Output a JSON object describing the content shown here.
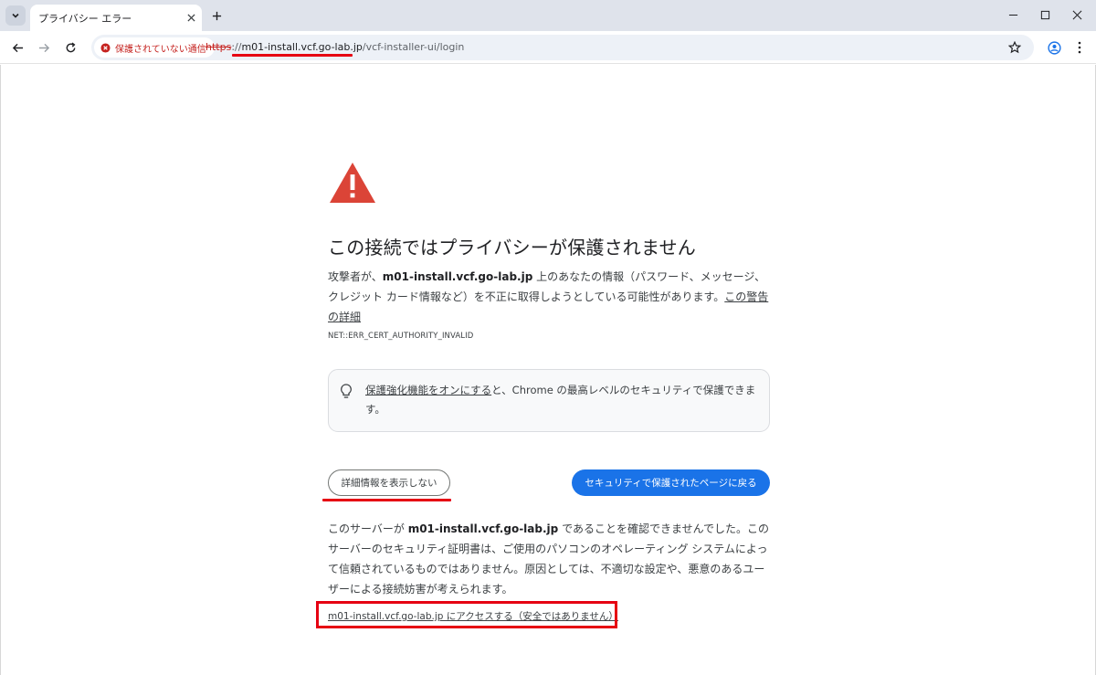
{
  "browser": {
    "tab_title": "プライバシー エラー",
    "address": {
      "security_label": "保護されていない通信",
      "url_scheme": "https",
      "url_sep": "://",
      "url_host": "m01-install.vcf.go-lab.jp",
      "url_path": "/vcf-installer-ui/login"
    },
    "icons": {
      "tab_search": "chevron-down-icon",
      "tab_close": "close-icon",
      "new_tab": "plus-icon",
      "back": "arrow-left-icon",
      "forward": "arrow-right-icon",
      "reload": "reload-icon",
      "security": "error-circle-icon",
      "bookmark": "star-icon",
      "profile": "account-icon",
      "menu": "more-vert-icon",
      "minimize": "minimize-icon",
      "maximize": "maximize-icon",
      "close": "close-icon"
    }
  },
  "page": {
    "heading": "この接続ではプライバシーが保護されません",
    "para1_prefix": "攻撃者が、",
    "para1_host": "m01-install.vcf.go-lab.jp",
    "para1_suffix": " 上のあなたの情報（パスワード、メッセージ、クレジット カード情報など）を不正に取得しようとしている可能性があります。",
    "para1_link": "この警告の詳細",
    "error_code": "NET::ERR_CERT_AUTHORITY_INVALID",
    "tip_link": "保護強化機能をオンにする",
    "tip_suffix": "と、Chrome の最高レベルのセキュリティで保護できます。",
    "details_button": "詳細情報を表示しない",
    "back_button": "セキュリティで保護されたページに戻る",
    "para2_prefix": "このサーバーが ",
    "para2_host": "m01-install.vcf.go-lab.jp",
    "para2_suffix": " であることを確認できませんでした。このサーバーのセキュリティ証明書は、ご使用のパソコンのオペレーティング システムによって信頼されているものではありません。原因としては、不適切な設定や、悪意のあるユーザーによる接続妨害が考えられます。",
    "proceed_link": "m01-install.vcf.go-lab.jp にアクセスする（安全ではありません）"
  },
  "colors": {
    "accent": "#1a73e8",
    "warning": "#db4437",
    "annotation": "#e60012",
    "insecure": "#c5221f"
  }
}
